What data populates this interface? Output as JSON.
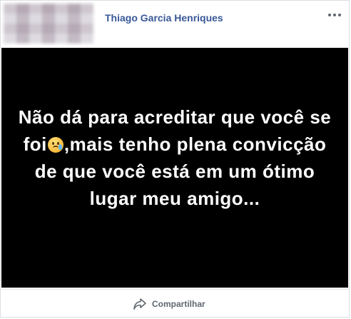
{
  "post": {
    "author_name": "Thiago Garcia Henriques",
    "image_text_before_emoji": "Não dá para acreditar que você se foi",
    "image_text_after_emoji": ",mais tenho plena convicção de que você está em um ótimo lugar meu amigo...",
    "emoji": "crying-face"
  },
  "actions": {
    "share_label": "Compartilhar"
  },
  "colors": {
    "author": "#385898",
    "media_background": "#000000",
    "media_text": "#ffffff",
    "action_text": "#606770"
  }
}
